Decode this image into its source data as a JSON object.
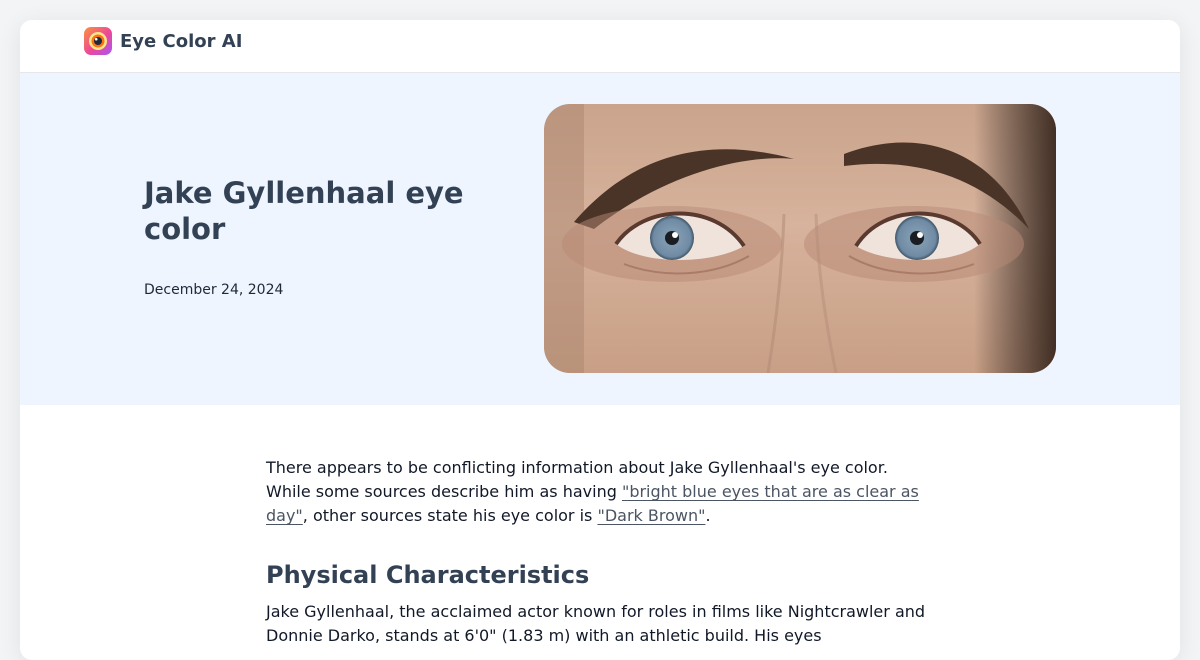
{
  "brand": {
    "name": "Eye Color AI",
    "logo_icon": "eye-logo-icon"
  },
  "hero": {
    "title": "Jake Gyllenhaal eye color",
    "date": "December 24, 2024",
    "image_subject": "close-up-eyes-photo"
  },
  "article": {
    "intro": {
      "text_1": "There appears to be conflicting information about Jake Gyllenhaal's eye color. While some sources describe him as having ",
      "link_1": "\"bright blue eyes that are as clear as day\"",
      "text_2": ", other sources state his eye color is ",
      "link_2": "\"Dark Brown\"",
      "text_3": "."
    },
    "section_heading": "Physical Characteristics",
    "section_body": "Jake Gyllenhaal, the acclaimed actor known for roles in films like Nightcrawler and Donnie Darko, stands at 6'0\" (1.83 m) with an athletic build. His eyes"
  },
  "colors": {
    "hero_background": "#eef5ff",
    "heading": "#334155",
    "link": "#4b5563",
    "iris": "#6f8aa3"
  }
}
